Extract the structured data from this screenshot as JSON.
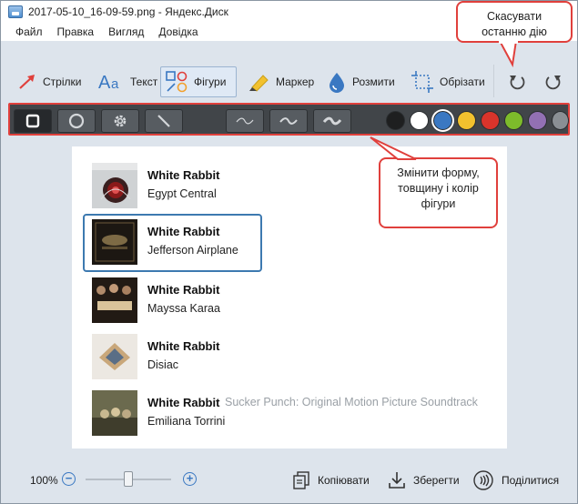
{
  "window": {
    "title": "2017-05-10_16-09-59.png - Яндекс.Диск"
  },
  "menu": [
    "Файл",
    "Правка",
    "Вигляд",
    "Довідка"
  ],
  "toolbar": {
    "tools": [
      {
        "label": "Стрілки",
        "icon": "arrow-icon"
      },
      {
        "label": "Текст",
        "icon": "text-icon"
      },
      {
        "label": "Фігури",
        "icon": "shapes-icon",
        "active": true
      },
      {
        "label": "Маркер",
        "icon": "marker-icon"
      },
      {
        "label": "Розмити",
        "icon": "blur-drop-icon"
      },
      {
        "label": "Обрізати",
        "icon": "crop-icon"
      }
    ],
    "undo_icon": "undo-icon",
    "redo_icon": "redo-icon"
  },
  "shape_options": {
    "shapes": [
      "square-shape-icon",
      "circle-shape-icon",
      "gear-shape-icon",
      "line-shape-icon"
    ],
    "selected_shape": "square-shape-icon",
    "thickness": [
      "thin-wave-icon",
      "medium-wave-icon",
      "thick-wave-icon"
    ],
    "colors": [
      "#1e1f20",
      "#ffffff",
      "#3a78c2",
      "#f2c12e",
      "#d9342b",
      "#7dbb2b",
      "#9270b3",
      "#8a8f94"
    ],
    "selected_color": "#3a78c2"
  },
  "tracks": [
    {
      "title": "White Rabbit",
      "album": "",
      "artist": "Egypt Central",
      "cover": "egypt-central-cover"
    },
    {
      "title": "White Rabbit",
      "album": "",
      "artist": "Jefferson Airplane",
      "cover": "jefferson-airplane-cover"
    },
    {
      "title": "White Rabbit",
      "album": "",
      "artist": "Mayssa Karaa",
      "cover": "american-hustle-cover"
    },
    {
      "title": "White Rabbit",
      "album": "",
      "artist": "Disiac",
      "cover": "disiac-cover"
    },
    {
      "title": "White Rabbit",
      "album": "Sucker Punch: Original Motion Picture Soundtrack",
      "artist": "Emiliana Torrini",
      "cover": "sucker-punch-cover"
    }
  ],
  "callouts": {
    "undo": [
      "Скасувати",
      "останню дію"
    ],
    "shape": [
      "Змінити форму,",
      "товщину і колір",
      "фігури"
    ]
  },
  "bottom": {
    "zoom": "100%",
    "zoom_level": 0.5,
    "copy_label": "Копіювати",
    "save_label": "Зберегти",
    "share_label": "Поділитися"
  },
  "colors": {
    "accent": "#3a78c2",
    "callout_border": "#e0403c",
    "options_bar": "#414549",
    "window_bg": "#dde4ec"
  }
}
